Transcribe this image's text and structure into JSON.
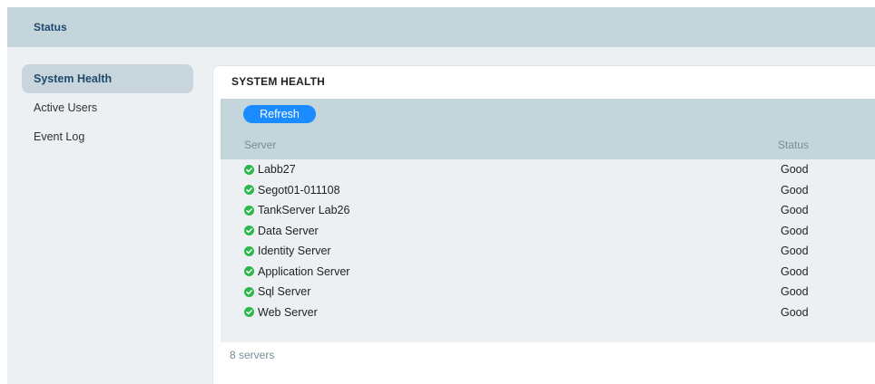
{
  "header": {
    "title": "Status"
  },
  "sidebar": {
    "items": [
      {
        "label": "System Health",
        "active": true
      },
      {
        "label": "Active Users",
        "active": false
      },
      {
        "label": "Event Log",
        "active": false
      }
    ]
  },
  "panel": {
    "title": "SYSTEM HEALTH",
    "refresh_label": "Refresh",
    "columns": {
      "server": "Server",
      "status": "Status"
    },
    "rows": [
      {
        "server": "Labb27",
        "status": "Good",
        "icon": "check-circle-icon"
      },
      {
        "server": "Segot01-011108",
        "status": "Good",
        "icon": "check-circle-icon"
      },
      {
        "server": "TankServer Lab26",
        "status": "Good",
        "icon": "check-circle-icon"
      },
      {
        "server": "Data Server",
        "status": "Good",
        "icon": "check-circle-icon"
      },
      {
        "server": "Identity Server",
        "status": "Good",
        "icon": "check-circle-icon"
      },
      {
        "server": "Application Server",
        "status": "Good",
        "icon": "check-circle-icon"
      },
      {
        "server": "Sql Server",
        "status": "Good",
        "icon": "check-circle-icon"
      },
      {
        "server": "Web Server",
        "status": "Good",
        "icon": "check-circle-icon"
      }
    ],
    "footer": "8 servers"
  },
  "colors": {
    "accent": "#1a8cff",
    "status_good": "#2db84d",
    "header_bg": "#c5d5dc",
    "title_color": "#1f4a6b"
  }
}
